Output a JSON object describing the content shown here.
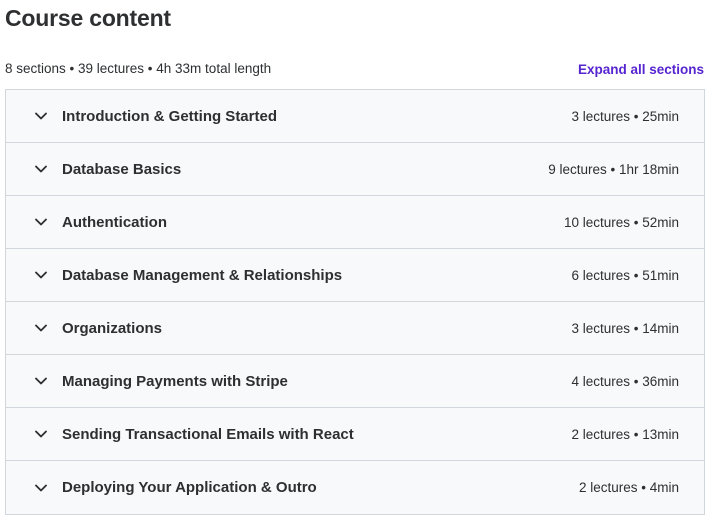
{
  "header": {
    "title": "Course content",
    "summary": "8 sections • 39 lectures • 4h 33m total length",
    "expand_label": "Expand all sections"
  },
  "colors": {
    "accent": "#5624d0",
    "section_bg": "#f7f9fa",
    "border": "#d1d7dc",
    "text": "#2d2f31"
  },
  "sections": [
    {
      "title": "Introduction & Getting Started",
      "meta": "3 lectures • 25min",
      "icon": "chevron-down-icon"
    },
    {
      "title": "Database Basics",
      "meta": "9 lectures • 1hr 18min",
      "icon": "chevron-down-icon"
    },
    {
      "title": "Authentication",
      "meta": "10 lectures • 52min",
      "icon": "chevron-down-icon"
    },
    {
      "title": "Database Management & Relationships",
      "meta": "6 lectures • 51min",
      "icon": "chevron-down-icon"
    },
    {
      "title": "Organizations",
      "meta": "3 lectures • 14min",
      "icon": "chevron-down-icon"
    },
    {
      "title": "Managing Payments with Stripe",
      "meta": "4 lectures • 36min",
      "icon": "chevron-down-icon"
    },
    {
      "title": "Sending Transactional Emails with React",
      "meta": "2 lectures • 13min",
      "icon": "chevron-down-icon"
    },
    {
      "title": "Deploying Your Application & Outro",
      "meta": "2 lectures • 4min",
      "icon": "chevron-down-icon"
    }
  ]
}
